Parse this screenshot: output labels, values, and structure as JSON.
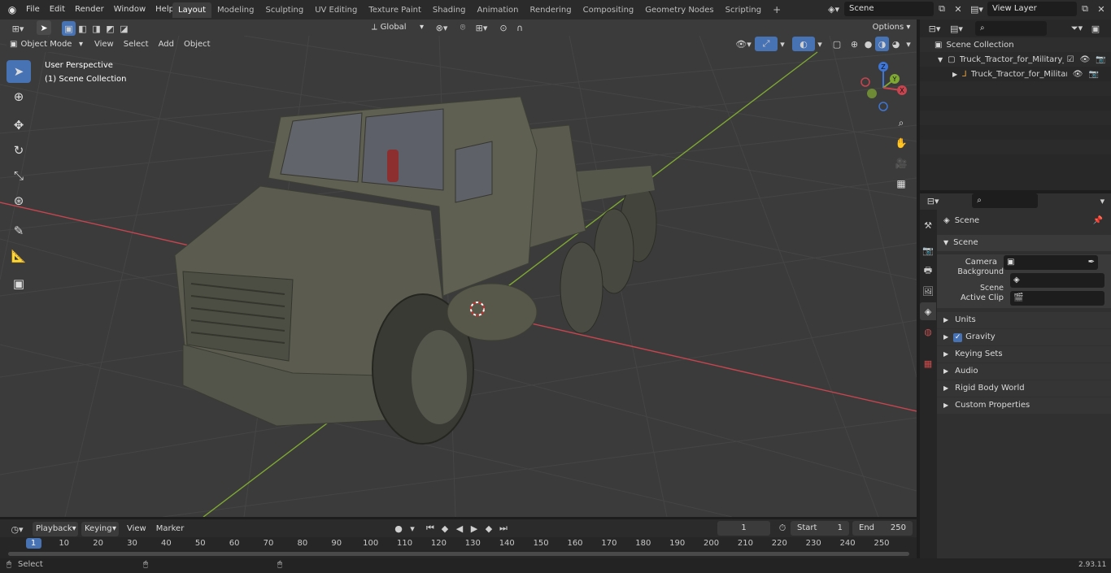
{
  "topbar": {
    "menus": [
      "File",
      "Edit",
      "Render",
      "Window",
      "Help"
    ],
    "workspaces": [
      "Layout",
      "Modeling",
      "Sculpting",
      "UV Editing",
      "Texture Paint",
      "Shading",
      "Animation",
      "Rendering",
      "Compositing",
      "Geometry Nodes",
      "Scripting"
    ],
    "active_workspace": "Layout",
    "scene_name": "Scene",
    "view_layer": "View Layer"
  },
  "viewport": {
    "mode": "Object Mode",
    "menus": [
      "View",
      "Select",
      "Add",
      "Object"
    ],
    "transform_orientation": "Global",
    "options_label": "Options",
    "perspective": "User Perspective",
    "collection_info": "(1) Scene Collection",
    "gizmo_axes": [
      "Z",
      "Y",
      "X"
    ]
  },
  "outliner": {
    "root": "Scene Collection",
    "collection": "Truck_Tractor_for_Military_Pu",
    "object": "Truck_Tractor_for_Militan"
  },
  "properties": {
    "context": "Scene",
    "section": "Scene",
    "fields": [
      {
        "label": "Camera",
        "value": ""
      },
      {
        "label": "Background Scene",
        "value": ""
      },
      {
        "label": "Active Clip",
        "value": ""
      }
    ],
    "panels": [
      "Units",
      "Gravity",
      "Keying Sets",
      "Audio",
      "Rigid Body World",
      "Custom Properties"
    ],
    "gravity_checked": true
  },
  "timeline": {
    "menus": [
      "Playback",
      "Keying",
      "View",
      "Marker"
    ],
    "current_frame": "1",
    "start_label": "Start",
    "start_value": "1",
    "end_label": "End",
    "end_value": "250",
    "ruler": [
      "1",
      "10",
      "20",
      "30",
      "40",
      "50",
      "60",
      "70",
      "80",
      "90",
      "100",
      "110",
      "120",
      "130",
      "140",
      "150",
      "160",
      "170",
      "180",
      "190",
      "200",
      "210",
      "220",
      "230",
      "240",
      "250"
    ]
  },
  "statusbar": {
    "left": "Select",
    "version": "2.93.11"
  },
  "colors": {
    "accent": "#4772b3",
    "x_axis": "#c8454f",
    "y_axis": "#7ea832",
    "z_axis": "#3d76d6"
  }
}
